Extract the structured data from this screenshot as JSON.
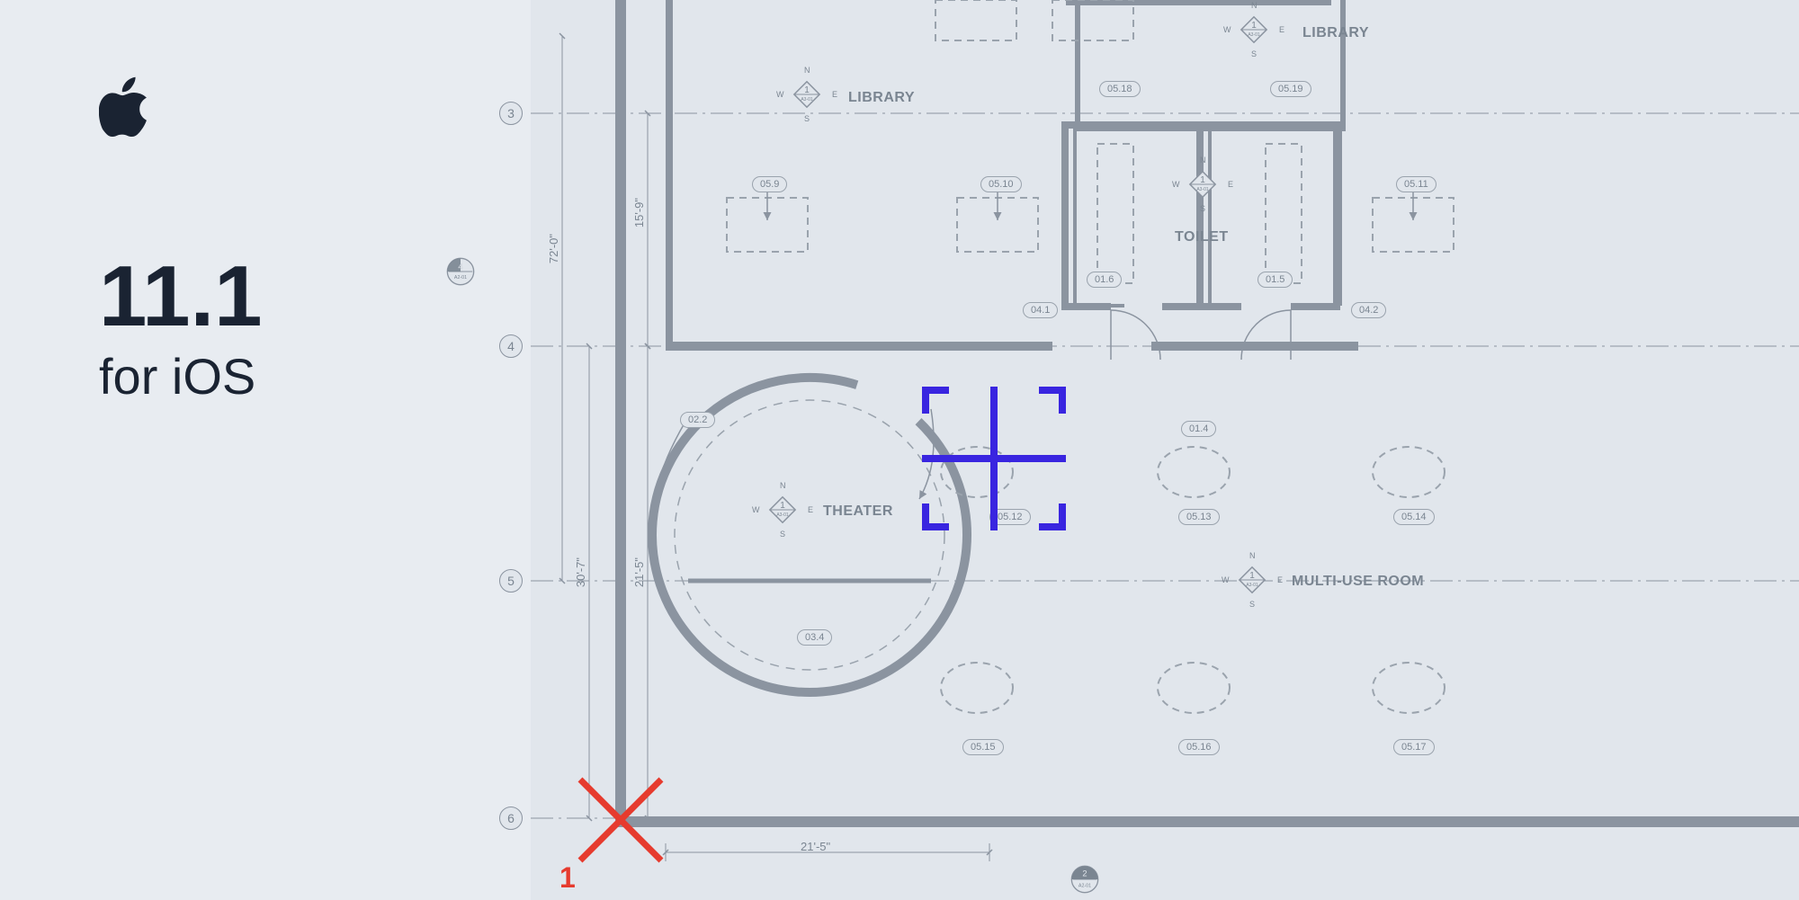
{
  "brand": {
    "version": "11.1",
    "platform": "for iOS"
  },
  "rooms": {
    "library1": "LIBRARY",
    "library2": "LIBRARY",
    "toilet": "TOILET",
    "theater": "THEATER",
    "multiuse": "MULTI-USE ROOM"
  },
  "tags": {
    "t02_2": "02.2",
    "t05_9": "05.9",
    "t05_10": "05.10",
    "t05_11": "05.11",
    "t05_18": "05.18",
    "t05_19": "05.19",
    "t01_4": "01.4",
    "t01_5": "01.5",
    "t01_6": "01.6",
    "t03_4": "03.4",
    "t04_1": "04.1",
    "t04_2": "04.2",
    "t05_12": "05.12",
    "t05_13": "05.13",
    "t05_14": "05.14",
    "t05_15": "05.15",
    "t05_16": "05.16",
    "t05_17": "05.17"
  },
  "dimensions": {
    "d72_0": "72'-0\"",
    "d15_9": "15'-9\"",
    "d21_5v": "21'-5\"",
    "d30_7": "30'-7\"",
    "d21_5h": "21'-5\""
  },
  "grid_labels": {
    "g3": "3",
    "g4": "4",
    "g5": "5",
    "g6": "6"
  },
  "section_refs": {
    "s4": {
      "num": "4",
      "sheet": "A2-01"
    },
    "s2": {
      "num": "2",
      "sheet": "A2-01"
    }
  },
  "compass_labels": {
    "n": "N",
    "s": "S",
    "e": "E",
    "w": "W",
    "ref_num": "1",
    "ref_sheet": "A3-01"
  },
  "markers": {
    "x_label": "1"
  }
}
